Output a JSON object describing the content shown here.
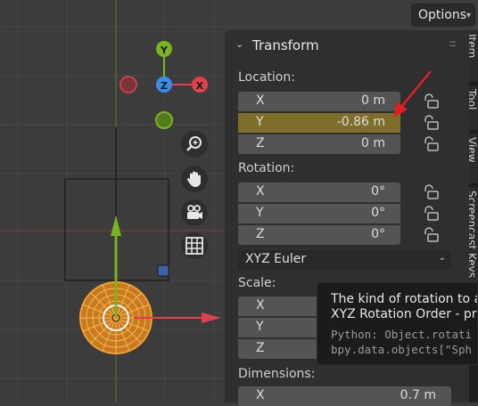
{
  "viewport": {
    "gizmo": {
      "y_label": "Y",
      "z_label": "Z",
      "x_label": "X"
    },
    "nav_tools": [
      "zoom-icon",
      "hand-pan-icon",
      "camera-icon",
      "grid-icon"
    ],
    "options_label": "Options"
  },
  "panel": {
    "title": "Transform",
    "location": {
      "label": "Location:",
      "fields": [
        {
          "axis": "X",
          "value": "0 m"
        },
        {
          "axis": "Y",
          "value": "-0.86 m"
        },
        {
          "axis": "Z",
          "value": "0 m"
        }
      ]
    },
    "rotation": {
      "label": "Rotation:",
      "fields": [
        {
          "axis": "X",
          "value": "0°"
        },
        {
          "axis": "Y",
          "value": "0°"
        },
        {
          "axis": "Z",
          "value": "0°"
        }
      ],
      "mode": "XYZ Euler"
    },
    "scale": {
      "label": "Scale:",
      "fields": [
        {
          "axis": "X"
        },
        {
          "axis": "Y"
        },
        {
          "axis": "Z"
        }
      ]
    },
    "dimensions": {
      "label": "Dimensions:",
      "fields": [
        {
          "axis": "X",
          "value": "0.7 m"
        }
      ]
    }
  },
  "sidebar_tabs": [
    "Item",
    "Tool",
    "View",
    "Screencast Keys"
  ],
  "tooltip": {
    "line1": "The kind of rotation to app",
    "line2": "XYZ Rotation Order - pro",
    "line3": "Python: Object.rotati",
    "line4": "bpy.data.objects[\"Sph"
  },
  "colors": {
    "active_field": "#7f6e2a",
    "x_axis": "#e0404e",
    "y_axis": "#7ab41e",
    "z_axis": "#3b8ee8",
    "selection": "#f0a030",
    "annotation_arrow": "#e02020"
  }
}
